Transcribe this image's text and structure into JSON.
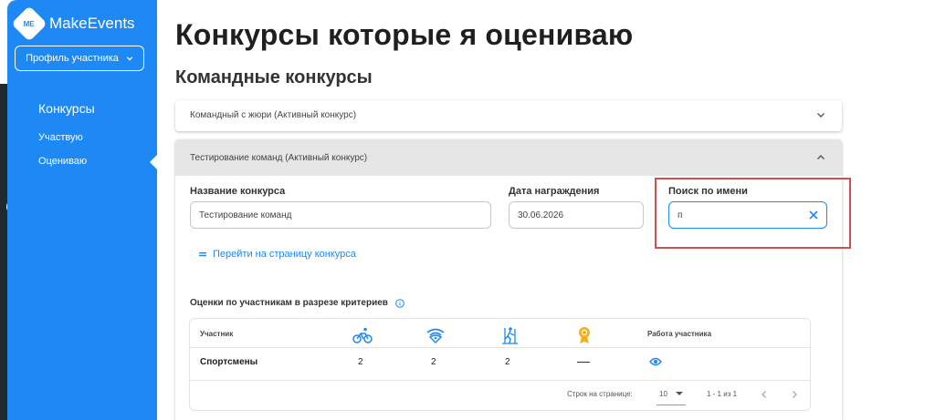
{
  "app": {
    "brand_name": "MakeEvents",
    "logo_text": "ME",
    "accent_color": "#1e88f5",
    "rail_color": "#23272e"
  },
  "rail": {
    "icons": [
      "person-icon",
      "group-icon",
      "chart-icon",
      "globe-icon",
      "grid-icon",
      "bag-icon"
    ]
  },
  "sidebar": {
    "profile_button_label": "Профиль участника",
    "section_title": "Конкурсы",
    "items": [
      {
        "label": "Участвую"
      },
      {
        "label": "Оцениваю",
        "active": true
      }
    ]
  },
  "main": {
    "page_title": "Конкурсы которые я оцениваю",
    "section_title": "Командные конкурсы",
    "accordions": [
      {
        "title": "Командный с жюри (Активный конкурс)",
        "expanded": false
      },
      {
        "title": "Тестирование команд (Активный конкурс)",
        "expanded": true
      }
    ],
    "contest_name_label": "Название конкурса",
    "contest_name_value": "Тестирование команд",
    "award_date_label": "Дата награждения",
    "award_date_value": "30.06.2026",
    "search_label": "Поиск по имени",
    "search_value": "п",
    "contest_page_link": "Перейти на страницу конкурса",
    "scores_title": "Оценки по участникам в разрезе критериев",
    "table": {
      "col_participant": "Участник",
      "criteria_icons": [
        "bicycle-icon",
        "wifi-icon",
        "ski-icon",
        "award-icon"
      ],
      "col_work": "Работа участника",
      "rows": [
        {
          "name": "Спортсмены",
          "scores": [
            "2",
            "2",
            "2",
            "—"
          ]
        }
      ],
      "rows_per_page_label": "Строк на странице:",
      "rows_per_page_value": "10",
      "range_label": "1 - 1 из 1"
    }
  }
}
